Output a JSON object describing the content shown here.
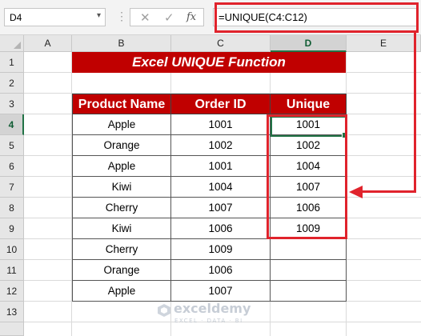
{
  "formula_bar": {
    "name_box": "D4",
    "name_box_arrow": "chevron-down-icon",
    "cancel_icon": "✕",
    "enter_icon": "✓",
    "fx_label": "fx",
    "formula": "=UNIQUE(C4:C12)"
  },
  "columns": [
    "A",
    "B",
    "C",
    "D",
    "E"
  ],
  "rows": [
    "1",
    "2",
    "3",
    "4",
    "5",
    "6",
    "7",
    "8",
    "9",
    "10",
    "11",
    "12",
    "13"
  ],
  "active_cell": "D4",
  "title": "Excel UNIQUE Function",
  "table": {
    "headers": [
      "Product Name",
      "Order ID",
      "Unique"
    ],
    "rows": [
      {
        "product": "Apple",
        "order_id": "1001",
        "unique": "1001"
      },
      {
        "product": "Orange",
        "order_id": "1002",
        "unique": "1002"
      },
      {
        "product": "Apple",
        "order_id": "1001",
        "unique": "1004"
      },
      {
        "product": "Kiwi",
        "order_id": "1004",
        "unique": "1007"
      },
      {
        "product": "Cherry",
        "order_id": "1007",
        "unique": "1006"
      },
      {
        "product": "Kiwi",
        "order_id": "1006",
        "unique": "1009"
      },
      {
        "product": "Cherry",
        "order_id": "1009",
        "unique": ""
      },
      {
        "product": "Orange",
        "order_id": "1006",
        "unique": ""
      },
      {
        "product": "Apple",
        "order_id": "1007",
        "unique": ""
      }
    ]
  },
  "colors": {
    "header_fill": "#c00000",
    "annotation": "#e0232c",
    "selection": "#217346"
  },
  "watermark": {
    "name": "exceldemy",
    "tagline": "EXCEL · DATA · BI"
  }
}
